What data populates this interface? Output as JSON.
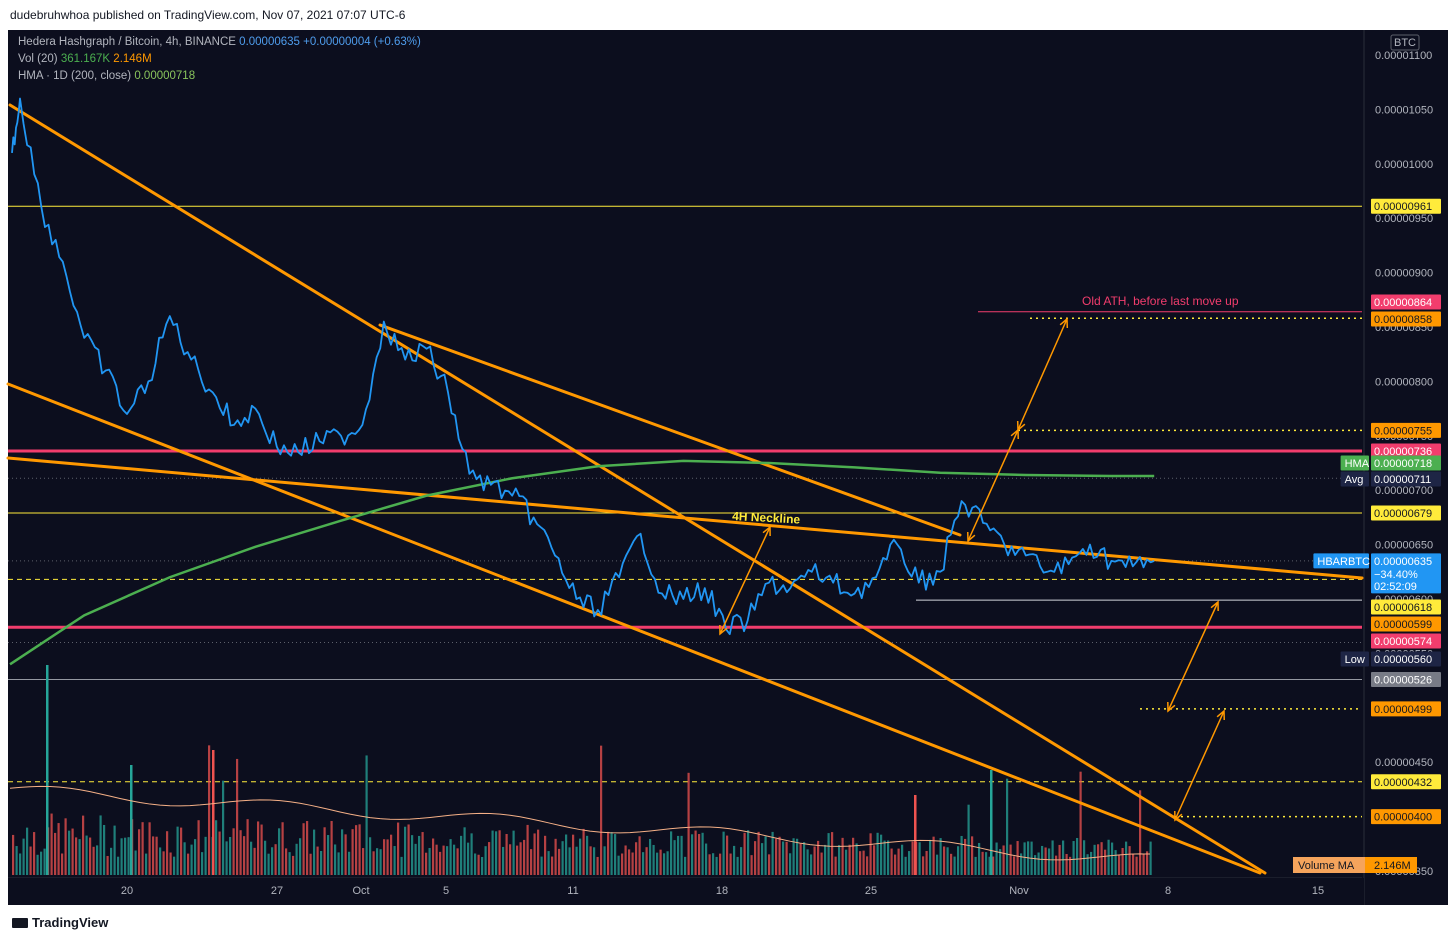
{
  "header": {
    "publisher_line": "dudebruhwhoa published on TradingView.com, Nov 07, 2021 07:07 UTC-6"
  },
  "legend": {
    "symbol_label": "Hedera Hashgraph / Bitcoin, 4h, BINANCE",
    "symbol_price": "0.00000635",
    "symbol_change": "+0.00000004 (+0.63%)",
    "vol_label": "Vol (20)",
    "vol_value_1": "361.167K",
    "vol_value_2": "2.146M",
    "hma_label": "HMA · 1D (200, close)",
    "hma_value": "0.00000718"
  },
  "footer": {
    "brand": "TradingView"
  },
  "colors": {
    "background": "#0c0e1e",
    "price_line": "#2196f3",
    "trendline": "#ff9800",
    "hma_line": "#4caf50",
    "red_level": "#f23d6d",
    "yellow_level": "#ffeb3b",
    "volume_up": "#26a69a",
    "volume_down": "#ef5350"
  },
  "chart_data": {
    "type": "line",
    "title": "Hedera Hashgraph / Bitcoin, 4h, BINANCE",
    "currency_label": "BTC",
    "x_ticks": [
      "20",
      "27",
      "Oct",
      "5",
      "11",
      "18",
      "25",
      "Nov",
      "8",
      "15"
    ],
    "y_ticks": [
      "0.00001100",
      "0.00001050",
      "0.00001000",
      "0.00000950",
      "0.00000900",
      "0.00000850",
      "0.00000800",
      "0.00000750",
      "0.00000700",
      "0.00000650",
      "0.00000600",
      "0.00000550",
      "0.00000500",
      "0.00000450",
      "0.00000400",
      "0.00000350"
    ],
    "ylim": [
      3.45e-06,
      1.125e-05
    ],
    "price_series": {
      "name": "HBARBTC",
      "x": [
        "Sep 14",
        "Sep 15",
        "Sep 16",
        "Sep 17",
        "Sep 18",
        "Sep 19",
        "Sep 20",
        "Sep 21",
        "Sep 22",
        "Sep 23",
        "Sep 24",
        "Sep 25",
        "Sep 26",
        "Sep 27",
        "Sep 28",
        "Sep 29",
        "Sep 30",
        "Oct 1",
        "Oct 2",
        "Oct 3",
        "Oct 4",
        "Oct 5",
        "Oct 6",
        "Oct 7",
        "Oct 8",
        "Oct 9",
        "Oct 10",
        "Oct 11",
        "Oct 12",
        "Oct 13",
        "Oct 14",
        "Oct 15",
        "Oct 16",
        "Oct 17",
        "Oct 18",
        "Oct 19",
        "Oct 20",
        "Oct 21",
        "Oct 22",
        "Oct 23",
        "Oct 24",
        "Oct 25",
        "Oct 26",
        "Oct 27",
        "Oct 28",
        "Oct 29",
        "Oct 30",
        "Oct 31",
        "Nov 1",
        "Nov 2",
        "Nov 3",
        "Nov 4",
        "Nov 5",
        "Nov 6",
        "Nov 7"
      ],
      "y": [
        1.01e-05,
        1.06e-05,
        9.6e-06,
        9.1e-06,
        8.4e-06,
        8.1e-06,
        7.7e-06,
        8e-06,
        8.6e-06,
        8.2e-06,
        7.9e-06,
        7.6e-06,
        7.75e-06,
        7.4e-06,
        7.35e-06,
        7.45e-06,
        7.5e-06,
        7.6e-06,
        8.55e-06,
        8.2e-06,
        8.3e-06,
        7.9e-06,
        7.15e-06,
        7.05e-06,
        6.95e-06,
        6.75e-06,
        6.4e-06,
        6e-06,
        5.9e-06,
        6.2e-06,
        6.6e-06,
        6.05e-06,
        6e-06,
        6.1e-06,
        5.72e-06,
        5.8e-06,
        6.15e-06,
        6.1e-06,
        6.25e-06,
        6.15e-06,
        6.05e-06,
        6.2e-06,
        6.5e-06,
        6.15e-06,
        6.25e-06,
        6.9e-06,
        6.7e-06,
        6.5e-06,
        6.4e-06,
        6.25e-06,
        6.32e-06,
        6.5e-06,
        6.35e-06,
        6.3e-06,
        6.35e-06
      ]
    },
    "hma_series": {
      "name": "HMA",
      "x": [
        "Sep 14",
        "Sep 18",
        "Sep 22",
        "Sep 26",
        "Sep 30",
        "Oct 4",
        "Oct 8",
        "Oct 12",
        "Oct 16",
        "Oct 20",
        "Oct 24",
        "Oct 28",
        "Nov 1",
        "Nov 5",
        "Nov 7"
      ],
      "y": [
        5.4e-06,
        5.85e-06,
        6.2e-06,
        6.48e-06,
        6.72e-06,
        6.95e-06,
        7.11e-06,
        7.22e-06,
        7.27e-06,
        7.25e-06,
        7.21e-06,
        7.16e-06,
        7.14e-06,
        7.13e-06,
        7.13e-06
      ]
    },
    "volume_ma": {
      "name": "Volume MA",
      "value": "2.146M"
    },
    "horizontal_levels": [
      {
        "value": "0.00000961",
        "color": "#ffeb3b",
        "style": "solid"
      },
      {
        "value": "0.00000736",
        "color": "#f23d6d",
        "style": "solid-thick"
      },
      {
        "value": "0.00000679",
        "color": "#ffeb3b",
        "style": "solid"
      },
      {
        "value": "0.00000618",
        "color": "#ffeb3b",
        "style": "dashed"
      },
      {
        "value": "0.00000574",
        "color": "#f23d6d",
        "style": "solid-thick"
      },
      {
        "value": "0.00000526",
        "color": "#9598a1",
        "style": "solid"
      },
      {
        "value": "0.00000432",
        "color": "#ffeb3b",
        "style": "dashed"
      }
    ],
    "annotations": [
      {
        "text": "4H Neckline",
        "color": "#ffeb3b"
      },
      {
        "text": "Old ATH, before last move up",
        "color": "#f23d6d"
      }
    ],
    "price_tags": [
      {
        "label": "",
        "value": "0.00000961",
        "bg": "#ffeb3b",
        "fg": "#131722"
      },
      {
        "label": "",
        "value": "0.00000864",
        "bg": "#f23d6d",
        "fg": "#ffffff"
      },
      {
        "label": "",
        "value": "0.00000858",
        "bg": "#ff9800",
        "fg": "#131722"
      },
      {
        "label": "",
        "value": "0.00000755",
        "bg": "#ff9800",
        "fg": "#131722"
      },
      {
        "label": "",
        "value": "0.00000736",
        "bg": "#f23d6d",
        "fg": "#ffffff"
      },
      {
        "label": "HMA",
        "value": "0.00000718",
        "bg": "#4caf50",
        "fg": "#ffffff"
      },
      {
        "label": "Avg",
        "value": "0.00000711",
        "bg": "#1e2545",
        "fg": "#ffffff"
      },
      {
        "label": "",
        "value": "0.00000679",
        "bg": "#ffeb3b",
        "fg": "#131722"
      },
      {
        "label": "HBARBTC",
        "value": "0.00000635",
        "bg": "#2196f3",
        "fg": "#ffffff",
        "extra": [
          "−34.40%",
          "02:52:09"
        ]
      },
      {
        "label": "",
        "value": "0.00000618",
        "bg": "#ffeb3b",
        "fg": "#131722"
      },
      {
        "label": "",
        "value": "0.00000599",
        "bg": "#ff9800",
        "fg": "#131722"
      },
      {
        "label": "",
        "value": "0.00000574",
        "bg": "#f23d6d",
        "fg": "#ffffff"
      },
      {
        "label": "Low",
        "value": "0.00000560",
        "bg": "#1e2545",
        "fg": "#ffffff"
      },
      {
        "label": "",
        "value": "0.00000526",
        "bg": "#787b86",
        "fg": "#ffffff"
      },
      {
        "label": "",
        "value": "0.00000499",
        "bg": "#ff9800",
        "fg": "#131722"
      },
      {
        "label": "",
        "value": "0.00000432",
        "bg": "#ffeb3b",
        "fg": "#131722"
      },
      {
        "label": "",
        "value": "0.00000400",
        "bg": "#ff9800",
        "fg": "#131722"
      }
    ],
    "grid": false,
    "legend_position": "top-left"
  }
}
